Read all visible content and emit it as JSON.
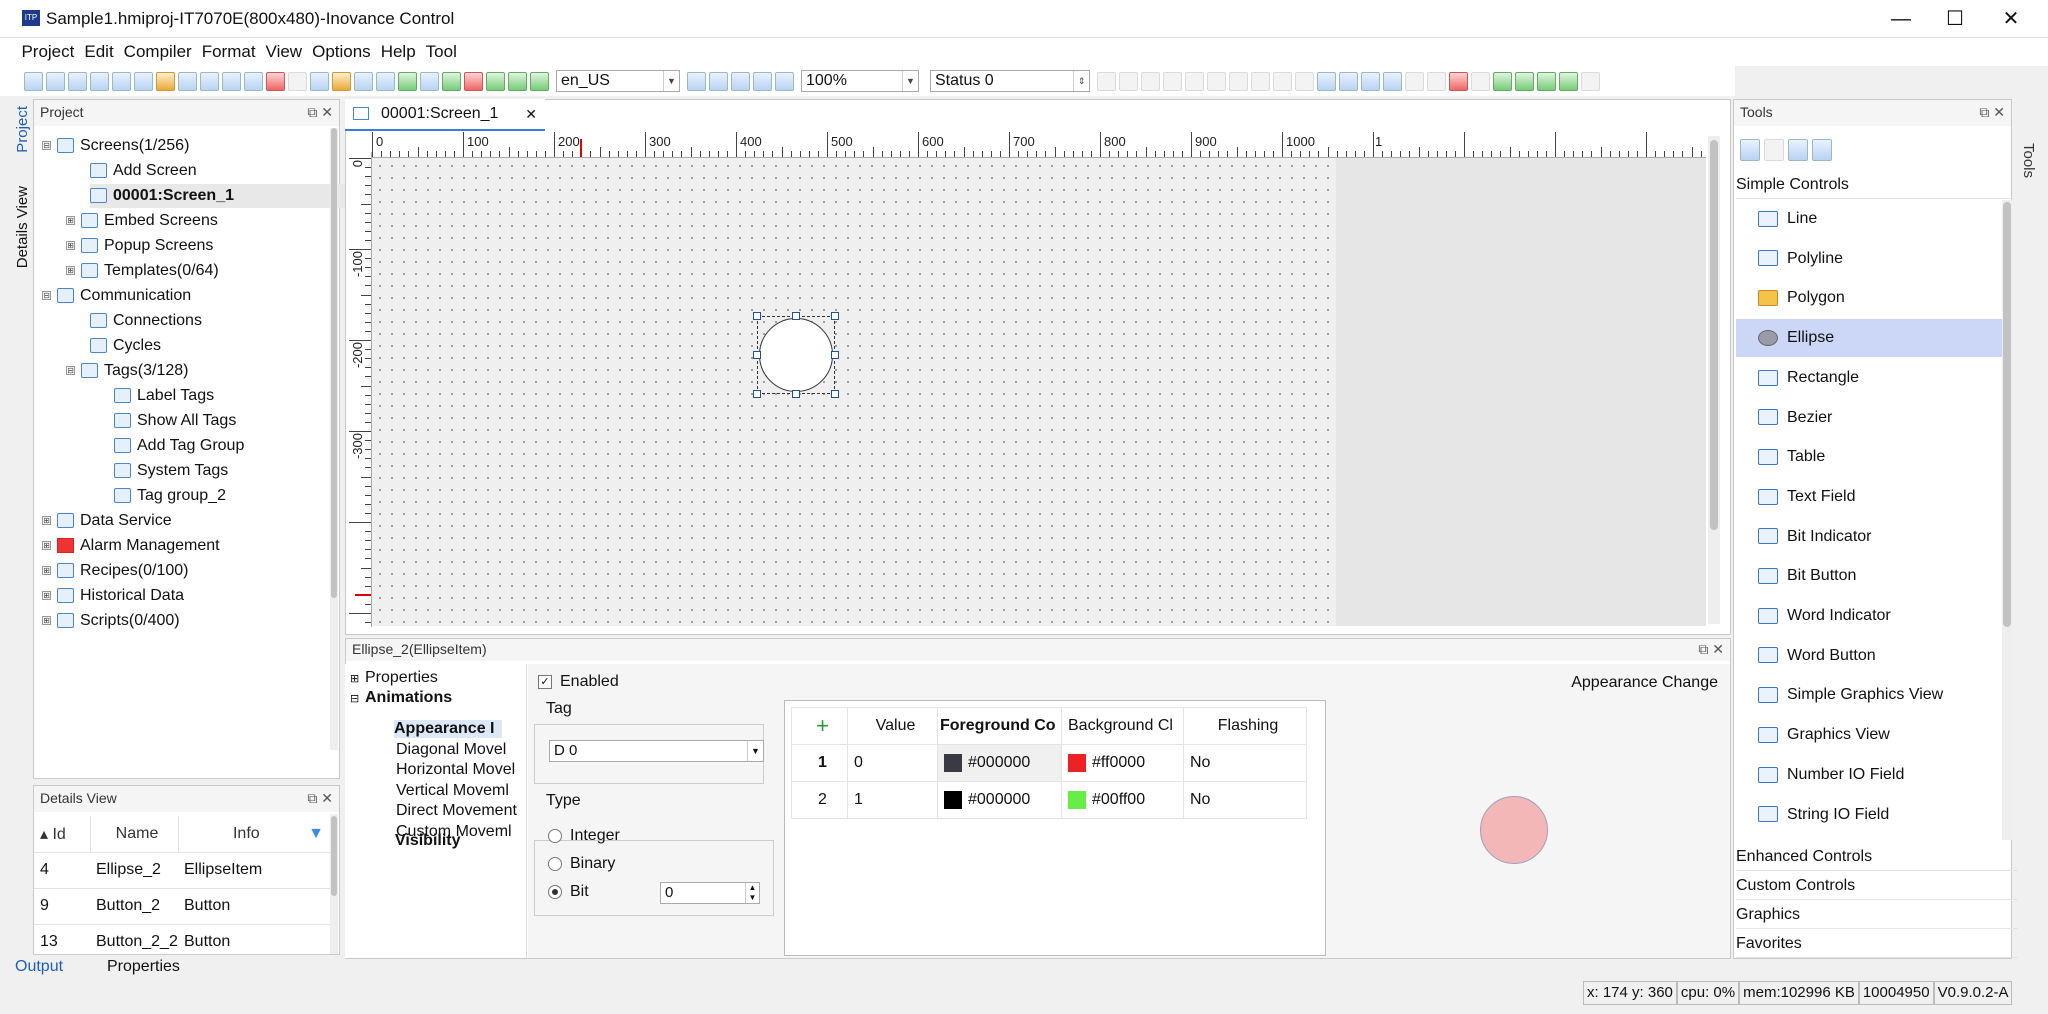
{
  "window": {
    "title": "Sample1.hmiproj-IT7070E(800x480)-Inovance Control",
    "minimize": "—",
    "maximize": "☐",
    "close": "✕"
  },
  "menu": [
    "Project",
    "Edit",
    "Compiler",
    "Format",
    "View",
    "Options",
    "Help",
    "Tool"
  ],
  "toolbar": {
    "language": "en_US",
    "zoom": "100%",
    "status": "Status 0"
  },
  "project_panel": {
    "title": "Project",
    "vertical_tabs": {
      "project": "Project",
      "details": "Details View"
    },
    "tree": [
      {
        "label": "Screens(1/256)",
        "expander": "⊟"
      },
      {
        "label": "Add Screen"
      },
      {
        "label": "00001:Screen_1"
      },
      {
        "label": "Embed Screens",
        "expander": "⊞"
      },
      {
        "label": "Popup Screens",
        "expander": "⊞"
      },
      {
        "label": "Templates(0/64)",
        "expander": "⊞"
      },
      {
        "label": "Communication",
        "expander": "⊟"
      },
      {
        "label": "Connections"
      },
      {
        "label": "Cycles"
      },
      {
        "label": "Tags(3/128)",
        "expander": "⊟"
      },
      {
        "label": "Label Tags"
      },
      {
        "label": "Show All Tags"
      },
      {
        "label": "Add Tag Group"
      },
      {
        "label": "System Tags"
      },
      {
        "label": "Tag group_2"
      },
      {
        "label": "Data Service",
        "expander": "⊞"
      },
      {
        "label": "Alarm Management",
        "expander": "⊞"
      },
      {
        "label": "Recipes(0/100)",
        "expander": "⊞"
      },
      {
        "label": "Historical Data",
        "expander": "⊞"
      },
      {
        "label": "Scripts(0/400)",
        "expander": "⊞"
      }
    ]
  },
  "details_view": {
    "title": "Details View",
    "columns": [
      "Id",
      "Name",
      "Info"
    ],
    "rows": [
      [
        "4",
        "Ellipse_2",
        "EllipseItem"
      ],
      [
        "9",
        "Button_2",
        "Button"
      ],
      [
        "13",
        "Button_2_2",
        "Button"
      ]
    ]
  },
  "bottom_tabs": [
    "Output",
    "Properties"
  ],
  "editor": {
    "tab": "00001:Screen_1",
    "ruler_h": [
      "0",
      "100",
      "200",
      "300",
      "400",
      "500",
      "600",
      "700",
      "800",
      "900",
      "1000",
      "1"
    ],
    "ruler_v": [
      "0",
      "-100",
      "-200",
      "-300"
    ]
  },
  "properties": {
    "title": "Ellipse_2(EllipseItem)",
    "tree": {
      "properties": "Properties",
      "animations": "Animations",
      "items": [
        "Appearance I",
        "Diagonal Movel",
        "Horizontal Movel",
        "Vertical Moveml",
        "Direct Movement",
        "Custom Moveml"
      ],
      "visibility": "Visibility"
    },
    "enabled": "Enabled",
    "header_right": "Appearance Change",
    "tag_label": "Tag",
    "tag_value": "D 0",
    "type_label": "Type",
    "types": [
      "Integer",
      "Binary",
      "Bit"
    ],
    "selected_type": "Bit",
    "bit_value": "0",
    "table": {
      "add": "+",
      "columns": [
        "Value",
        "Foreground Co",
        "Background Cl",
        "Flashing"
      ],
      "rows": [
        {
          "n": "1",
          "value": "0",
          "fg": "#000000",
          "fg_swatch": "#3a3a44",
          "bg": "#ff0000",
          "bg_swatch": "#ee2222",
          "flashing": "No"
        },
        {
          "n": "2",
          "value": "1",
          "fg": "#000000",
          "fg_swatch": "#000000",
          "bg": "#00ff00",
          "bg_swatch": "#66ee44",
          "flashing": "No"
        }
      ]
    },
    "preview_color": "#f4b7b7"
  },
  "tools": {
    "title": "Tools",
    "vertical_tab": "Tools",
    "section": "Simple Controls",
    "items": [
      "Line",
      "Polyline",
      "Polygon",
      "Ellipse",
      "Rectangle",
      "Bezier",
      "Table",
      "Text Field",
      "Bit Indicator",
      "Bit Button",
      "Word Indicator",
      "Word Button",
      "Simple Graphics View",
      "Graphics View",
      "Number IO Field",
      "String IO Field"
    ],
    "selected": "Ellipse",
    "sections": [
      "Enhanced Controls",
      "Custom Controls",
      "Graphics",
      "Favorites"
    ]
  },
  "status_bar": {
    "coords": "x: 174 y: 360",
    "cpu": "cpu: 0%",
    "mem": "mem:102996 KB",
    "num": "10004950",
    "version": "V0.9.0.2-A"
  }
}
